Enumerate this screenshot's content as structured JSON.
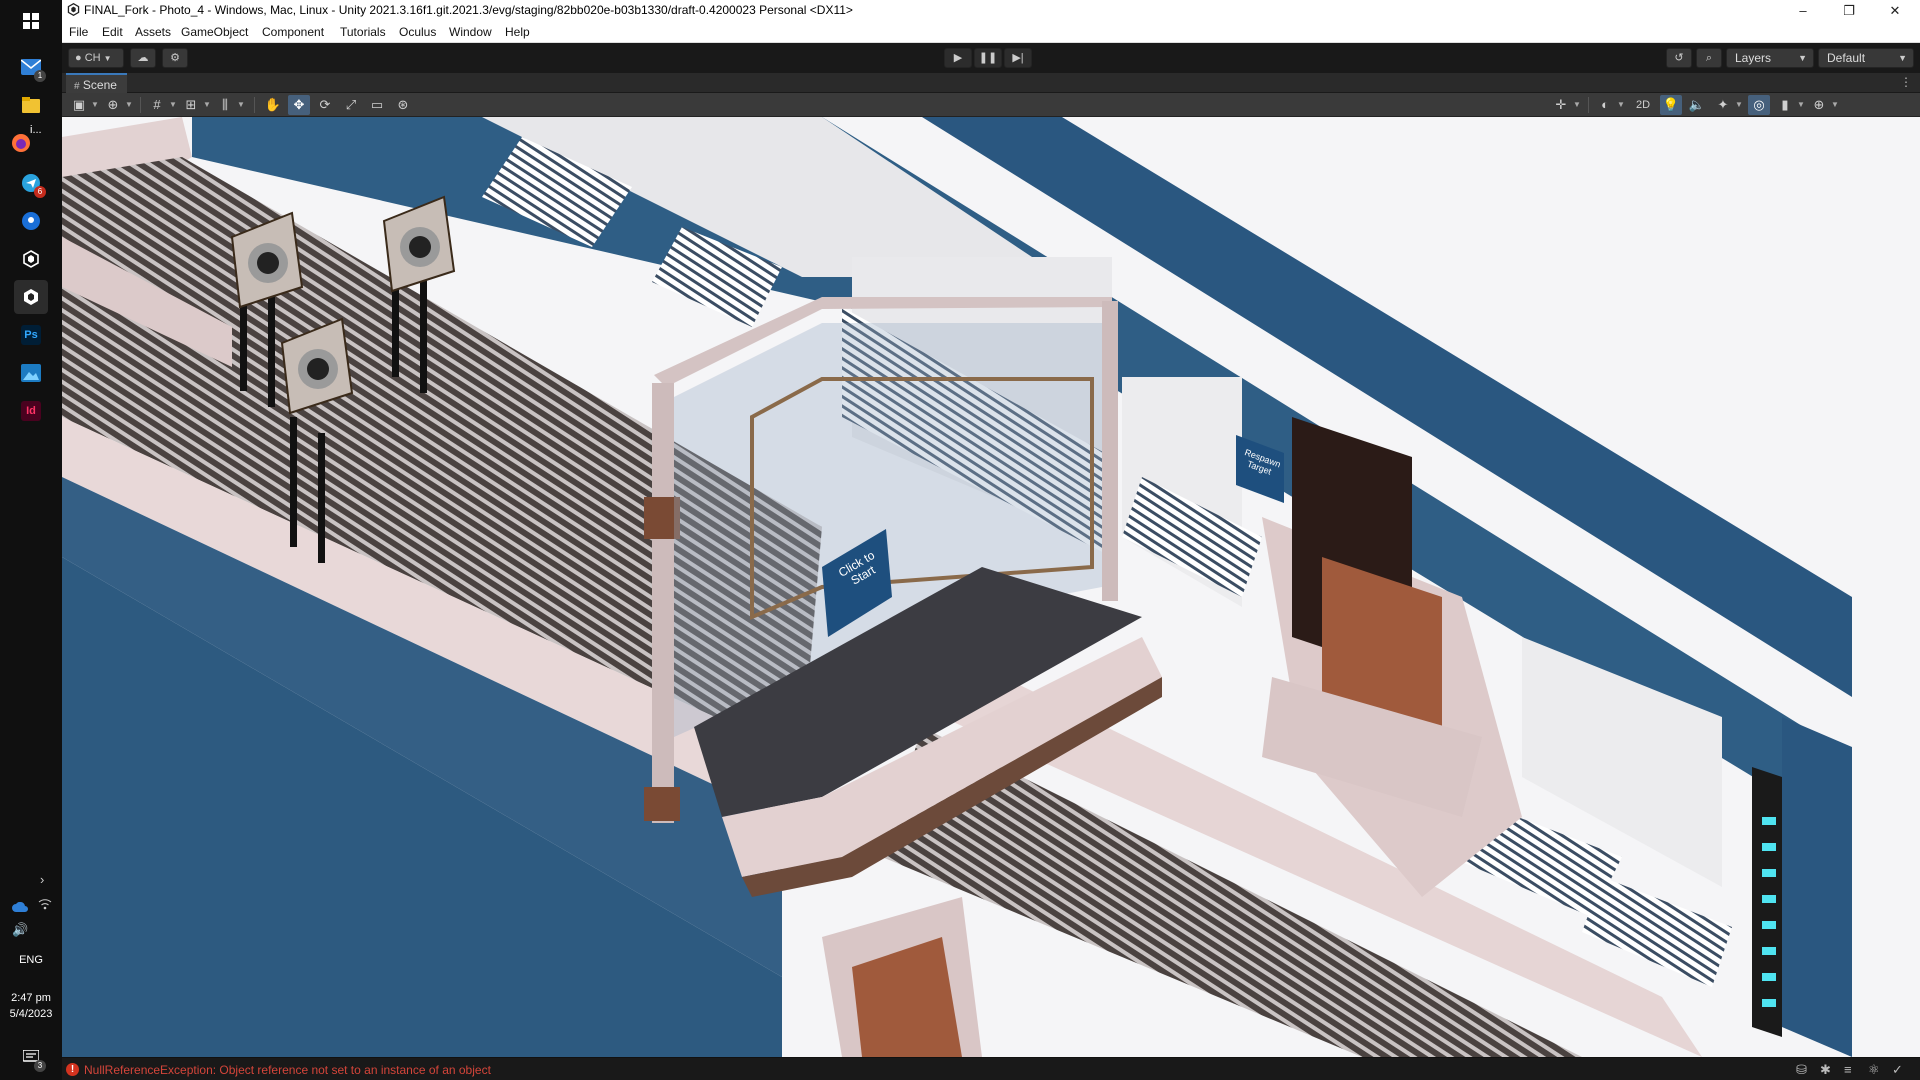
{
  "taskbar": {
    "mail_badge": "1",
    "firefox_label": "i...",
    "telegram_badge": "6",
    "photoshop_label": "Ps",
    "indesign_label": "Id",
    "language": "ENG",
    "time": "2:47 pm",
    "date": "5/4/2023",
    "notifications_badge": "3"
  },
  "window": {
    "title": "FINAL_Fork - Photo_4 - Windows, Mac, Linux - Unity 2021.3.16f1.git.2021.3/evg/staging/82bb020e-b03b1330/draft-0.4200023 Personal <DX11>",
    "minimize": "–",
    "restore": "❐",
    "close": "✕"
  },
  "menu": {
    "items": [
      "File",
      "Edit",
      "Assets",
      "GameObject",
      "Component",
      "Tutorials",
      "Oculus",
      "Window",
      "Help"
    ]
  },
  "toolbar": {
    "account_label": "CH",
    "layers_label": "Layers",
    "layout_label": "Default"
  },
  "scene": {
    "tab_label": "Scene",
    "toggle_2d": "2D",
    "sign_click_to_start": "Click to Start",
    "sign_respawn": "Respawn Target"
  },
  "status": {
    "error_message": "NullReferenceException: Object reference not set to an instance of an object"
  },
  "colors": {
    "wall_blue": "#2e5b82",
    "panel_pink": "#e7d6d6",
    "floor_brown": "#6c4a3a",
    "accent_cyan": "#4fe3f0",
    "error_red": "#d4453a"
  }
}
